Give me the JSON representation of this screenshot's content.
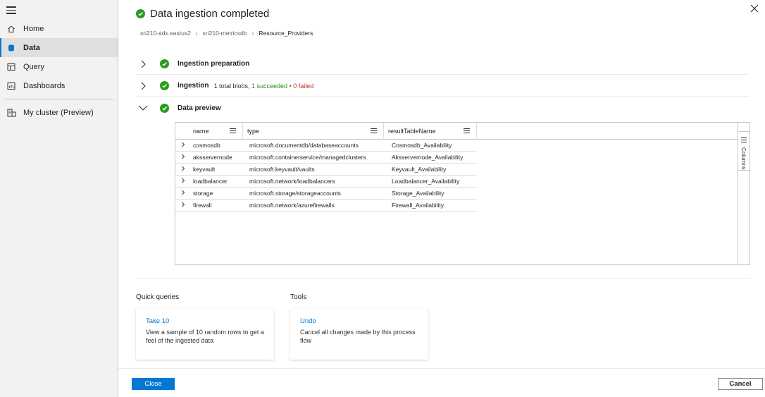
{
  "sidebar": {
    "items": [
      {
        "label": "Home",
        "icon": "home-icon"
      },
      {
        "label": "Data",
        "icon": "database-icon",
        "active": true
      },
      {
        "label": "Query",
        "icon": "query-icon"
      },
      {
        "label": "Dashboards",
        "icon": "dashboard-icon"
      },
      {
        "label": "My cluster (Preview)",
        "icon": "cluster-icon"
      }
    ]
  },
  "header": {
    "title": "Data ingestion completed",
    "breadcrumb": [
      "sri210-adx.eastus2",
      "sri210-metricsdb",
      "Resource_Providers"
    ]
  },
  "sections": {
    "preparation": {
      "label": "Ingestion preparation"
    },
    "ingestion": {
      "label": "Ingestion",
      "total": "1 total blobs,",
      "succeeded": "1 succeeded",
      "dot": "•",
      "failed": "0 failed"
    },
    "preview": {
      "label": "Data preview"
    }
  },
  "grid": {
    "columns": [
      "name",
      "type",
      "resultTableName"
    ],
    "side_panel": "Columns",
    "rows": [
      [
        "cosmosdb",
        "microsoft.documentdb/databaseaccounts",
        "Cosmosdb_Availability"
      ],
      [
        "aksservernode",
        "microsoft.containerservice/managedclusters",
        "Aksservernode_Availability"
      ],
      [
        "keyvault",
        "microsoft.keyvault/vaults",
        "Keyvault_Availability"
      ],
      [
        "loadbalancer",
        "microsoft.network/loadbalancers",
        "Loadbalancer_Availability"
      ],
      [
        "storage",
        "microsoft.storage/storageaccounts",
        "Storage_Availability"
      ],
      [
        "firewall",
        "microsoft.network/azurefirewalls",
        "Firewall_Availability"
      ]
    ]
  },
  "quick_queries": {
    "title": "Quick queries",
    "card": {
      "link": "Take 10",
      "desc": "View a sample of 10 random rows to get a feel of the ingested data"
    }
  },
  "tools": {
    "title": "Tools",
    "card": {
      "link": "Undo",
      "desc": "Cancel all changes made by this process flow"
    }
  },
  "footer": {
    "close_label": "Close",
    "cancel_label": "Cancel"
  },
  "colors": {
    "accent": "#0078d4",
    "success": "#2b9a1e",
    "failure": "#c62828"
  }
}
